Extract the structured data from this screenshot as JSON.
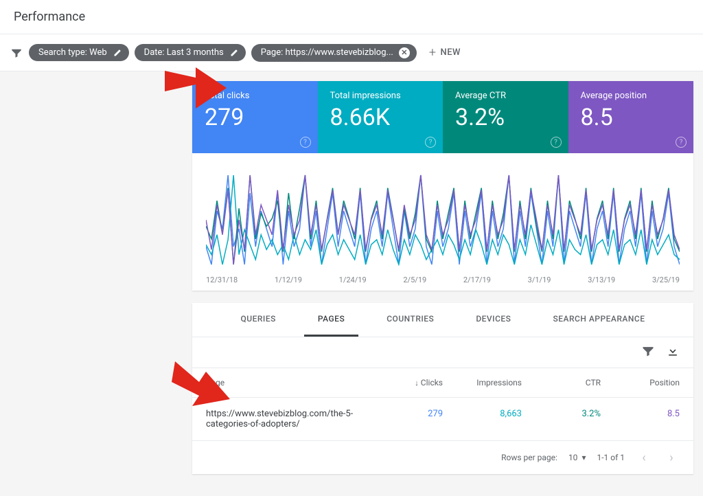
{
  "page_title": "Performance",
  "filters": {
    "search_type": "Search type: Web",
    "date": "Date: Last 3 months",
    "page": "Page: https://www.stevebizblog...",
    "new_label": "NEW"
  },
  "metrics": {
    "clicks": {
      "label": "Total clicks",
      "value": "279"
    },
    "impressions": {
      "label": "Total impressions",
      "value": "8.66K"
    },
    "ctr": {
      "label": "Average CTR",
      "value": "3.2%"
    },
    "position": {
      "label": "Average position",
      "value": "8.5"
    }
  },
  "chart_data": {
    "type": "line",
    "xlabels": [
      "12/31/18",
      "1/12/19",
      "1/24/19",
      "2/5/19",
      "2/17/19",
      "3/1/19",
      "3/13/19",
      "3/25/19"
    ],
    "series": [
      {
        "name": "clicks",
        "color": "#4285f4",
        "values": [
          3,
          2,
          5,
          4,
          7,
          3,
          4,
          2,
          6,
          3,
          5,
          4,
          3,
          6,
          2,
          5,
          3,
          4,
          7,
          3,
          5,
          2,
          4,
          6,
          3,
          5,
          4,
          3,
          6,
          2,
          4,
          5,
          3,
          6,
          4,
          2,
          5,
          3,
          4,
          7,
          3,
          2,
          5,
          3,
          4,
          6,
          2,
          5,
          3,
          4,
          6,
          2,
          5,
          3,
          4,
          7,
          2,
          5,
          3,
          6,
          4,
          2,
          5,
          3,
          7,
          2,
          5,
          4,
          3,
          6,
          2,
          4,
          5,
          3,
          6,
          2,
          4,
          5,
          3,
          6,
          2,
          5,
          3,
          4,
          6,
          3,
          2
        ]
      },
      {
        "name": "impressions",
        "color": "#00acc1",
        "values": [
          80,
          70,
          90,
          60,
          85,
          150,
          70,
          95,
          80,
          65,
          90,
          75,
          85,
          70,
          80,
          65,
          90,
          70,
          85,
          75,
          95,
          60,
          80,
          90,
          70,
          85,
          75,
          65,
          90,
          60,
          80,
          85,
          70,
          95,
          75,
          60,
          85,
          70,
          90,
          80,
          65,
          75,
          85,
          70,
          90,
          80,
          65,
          85,
          70,
          95,
          80,
          60,
          85,
          70,
          90,
          80,
          60,
          85,
          70,
          100,
          80,
          60,
          85,
          70,
          95,
          60,
          85,
          75,
          70,
          90,
          60,
          80,
          85,
          70,
          95,
          60,
          80,
          85,
          70,
          95,
          60,
          85,
          70,
          80,
          90,
          70,
          65
        ]
      },
      {
        "name": "ctr",
        "color": "#00897b",
        "values": [
          3.5,
          3.0,
          4.5,
          3.2,
          5.0,
          2.0,
          4.2,
          2.5,
          5.5,
          3.0,
          4.0,
          3.5,
          3.8,
          4.5,
          2.5,
          4.8,
          3.0,
          4.2,
          5.5,
          3.0,
          4.5,
          2.5,
          3.8,
          5.0,
          3.2,
          4.5,
          3.8,
          3.0,
          5.0,
          2.5,
          3.8,
          4.5,
          3.0,
          5.0,
          3.8,
          2.5,
          4.2,
          3.0,
          4.0,
          5.5,
          3.0,
          2.5,
          4.5,
          3.0,
          4.0,
          5.0,
          2.5,
          4.5,
          3.0,
          4.0,
          5.0,
          2.5,
          4.5,
          3.0,
          4.0,
          5.5,
          2.5,
          4.5,
          3.0,
          5.0,
          3.5,
          2.5,
          4.5,
          3.0,
          5.5,
          2.5,
          4.5,
          3.8,
          3.0,
          5.0,
          2.5,
          3.8,
          4.5,
          3.0,
          5.0,
          2.5,
          3.8,
          4.5,
          3.0,
          5.0,
          2.5,
          4.5,
          3.0,
          3.8,
          5.0,
          3.0,
          2.5
        ]
      },
      {
        "name": "position",
        "color": "#7e57c2",
        "values": [
          8.5,
          8.3,
          8.6,
          8.4,
          8.7,
          8.2,
          8.5,
          8.3,
          8.8,
          8.4,
          8.6,
          8.5,
          8.4,
          8.7,
          8.3,
          8.6,
          8.4,
          8.5,
          8.8,
          8.4,
          8.6,
          8.3,
          8.5,
          8.7,
          8.4,
          8.6,
          8.5,
          8.4,
          8.7,
          8.3,
          8.5,
          8.6,
          8.4,
          8.7,
          8.5,
          8.3,
          8.6,
          8.4,
          8.5,
          8.8,
          8.4,
          8.3,
          8.6,
          8.4,
          8.5,
          8.7,
          8.3,
          8.6,
          8.4,
          8.5,
          8.7,
          8.3,
          8.6,
          8.4,
          8.5,
          8.8,
          8.3,
          8.6,
          8.4,
          8.7,
          8.5,
          8.3,
          8.6,
          8.4,
          8.8,
          8.3,
          8.6,
          8.5,
          8.4,
          8.7,
          8.3,
          8.5,
          8.6,
          8.4,
          8.7,
          8.3,
          8.5,
          8.6,
          8.4,
          8.7,
          8.3,
          8.6,
          8.4,
          8.5,
          8.7,
          8.4,
          8.3
        ]
      }
    ]
  },
  "tabs": [
    "QUERIES",
    "PAGES",
    "COUNTRIES",
    "DEVICES",
    "SEARCH APPEARANCE"
  ],
  "active_tab": 1,
  "table": {
    "columns": {
      "page": "Page",
      "clicks": "Clicks",
      "impressions": "Impressions",
      "ctr": "CTR",
      "position": "Position"
    },
    "rows": [
      {
        "page": "https://www.stevebizblog.com/the-5-categories-of-adopters/",
        "clicks": "279",
        "impressions": "8,663",
        "ctr": "3.2%",
        "position": "8.5"
      }
    ]
  },
  "pagination": {
    "rows_label": "Rows per page:",
    "rows_value": "10",
    "range": "1-1 of 1"
  }
}
